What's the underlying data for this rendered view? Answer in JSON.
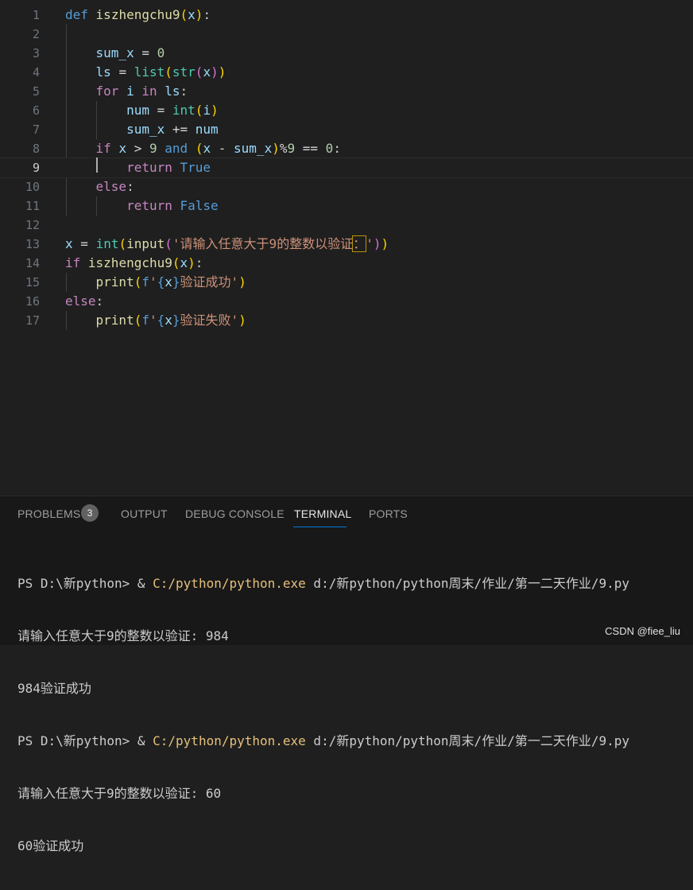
{
  "editor": {
    "code_lines": [
      "def iszhengchu9(x):",
      "",
      "    sum_x = 0",
      "    ls = list(str(x))",
      "    for i in ls:",
      "        num = int(i)",
      "        sum_x += num",
      "    if x > 9 and (x - sum_x)%9 == 0:",
      "        return True",
      "    else:",
      "        return False",
      "",
      "x = int(input('请输入任意大于9的整数以验证：'))",
      "if iszhengchu9(x):",
      "    print(f'{x}验证成功')",
      "else:",
      "    print(f'{x}验证失败')"
    ],
    "line_numbers": [
      "1",
      "2",
      "3",
      "4",
      "5",
      "6",
      "7",
      "8",
      "9",
      "10",
      "11",
      "12",
      "13",
      "14",
      "15",
      "16",
      "17"
    ],
    "active_line": "9"
  },
  "panel": {
    "tabs": [
      {
        "label": "PROBLEMS",
        "badge": "3"
      },
      {
        "label": "OUTPUT"
      },
      {
        "label": "DEBUG CONSOLE"
      },
      {
        "label": "TERMINAL",
        "active": true
      },
      {
        "label": "PORTS"
      }
    ],
    "terminal": {
      "runs": [
        {
          "prompt": "PS D:\\新python> & ",
          "exe": "C:/python/python.exe",
          "script": " d:/新python/python周末/作业/第一二天作业/9.py",
          "input_line": "请输入任意大于9的整数以验证: 984",
          "result": "984验证成功"
        },
        {
          "prompt": "PS D:\\新python> & ",
          "exe": "C:/python/python.exe",
          "script": " d:/新python/python周末/作业/第一二天作业/9.py",
          "input_line": "请输入任意大于9的整数以验证: 60",
          "result": "60验证成功"
        }
      ]
    }
  },
  "watermark": "CSDN @fiee_liu",
  "colors": {
    "background": "#1f1f1f",
    "keyword": "#569cd6",
    "control_keyword": "#c586c0",
    "function": "#dcdcaa",
    "variable": "#9cdcfe",
    "number": "#b5cea8",
    "string": "#ce9178",
    "builtin": "#4ec9b0",
    "accent": "#0078d4"
  }
}
